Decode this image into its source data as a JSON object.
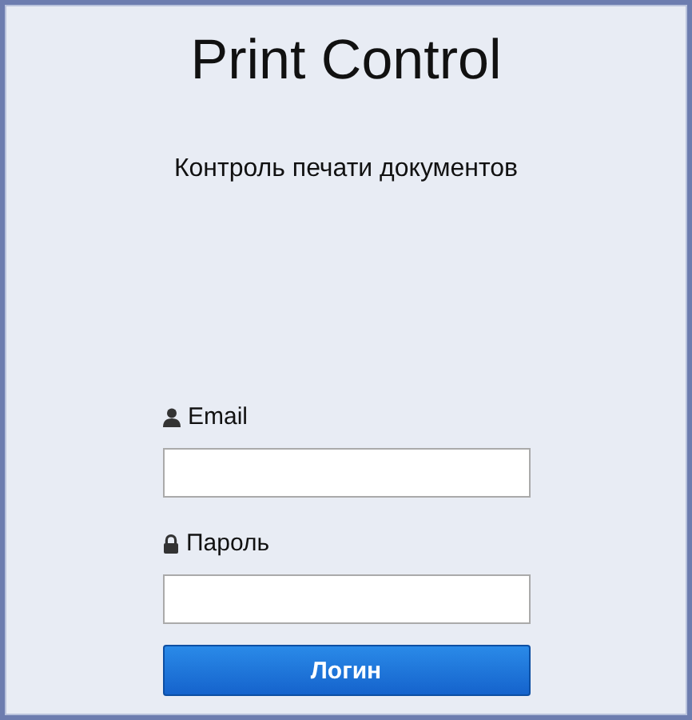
{
  "title": "Print Control",
  "subtitle": "Контроль печати документов",
  "fields": [
    {
      "kind": "user",
      "label": "Email"
    },
    {
      "kind": "lock",
      "label": "Пароль"
    }
  ],
  "button": "Логин"
}
